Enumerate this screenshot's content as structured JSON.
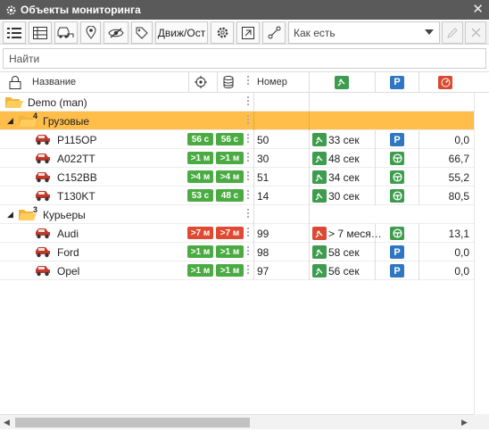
{
  "window": {
    "title": "Объекты мониторинга"
  },
  "toolbar": {
    "move_stop_label": "Движ/Ост",
    "mode_value": "Как есть",
    "buttons": [
      "list-icon",
      "table-icon",
      "vehicles-icon",
      "geofence-icon",
      "hide-icon",
      "tag-icon",
      "settings-icon",
      "export-icon",
      "route-icon",
      "edit-icon",
      "close-icon"
    ]
  },
  "search": {
    "placeholder": "Найти"
  },
  "columns": {
    "name": "Название",
    "number": "Номер"
  },
  "tree": {
    "root": "Demo (man)",
    "groups": [
      {
        "label": "Грузовые",
        "count": "4"
      },
      {
        "label": "Курьеры",
        "count": "3"
      }
    ]
  },
  "units": [
    {
      "name": "P115OP",
      "b1": "56 с",
      "b2": "56 с",
      "b1_color": "#4bab43",
      "b2_color": "#4bab43",
      "number": "50",
      "time": "33 сек",
      "sensor": "green",
      "value": "0,0"
    },
    {
      "name": "A022TT",
      "b1": ">1 м",
      "b2": ">1 м",
      "b1_color": "#4bab43",
      "b2_color": "#4bab43",
      "number": "30",
      "time": "48 сек",
      "sensor": "wheel",
      "value": "66,7"
    },
    {
      "name": "C152BB",
      "b1": ">4 м",
      "b2": ">4 м",
      "b1_color": "#4bab43",
      "b2_color": "#4bab43",
      "number": "51",
      "time": "34 сек",
      "sensor": "wheel",
      "value": "55,2"
    },
    {
      "name": "T130KT",
      "b1": "53 с",
      "b2": "48 с",
      "b1_color": "#4bab43",
      "b2_color": "#4bab43",
      "number": "14",
      "time": "30 сек",
      "sensor": "wheel",
      "value": "80,5"
    },
    {
      "name": "Audi",
      "b1": ">7 м",
      "b2": ">7 м",
      "b1_color": "#e04a32",
      "b2_color": "#e04a32",
      "number": "99",
      "time": "> 7 меся…",
      "sensor": "wheel",
      "value": "13,1"
    },
    {
      "name": "Ford",
      "b1": ">1 м",
      "b2": ">1 м",
      "b1_color": "#4bab43",
      "b2_color": "#4bab43",
      "number": "98",
      "time": "58 сек",
      "sensor": "parking",
      "value": "0,0"
    },
    {
      "name": "Opel",
      "b1": ">1 м",
      "b2": ">1 м",
      "b1_color": "#4bab43",
      "b2_color": "#4bab43",
      "number": "97",
      "time": "56 сек",
      "sensor": "parking",
      "value": "0,0"
    }
  ],
  "parking_label": "P",
  "colors": {
    "accent": "#ffbd4a",
    "titlebar": "#5a5a5a",
    "green": "#4bab43",
    "red": "#e04a32",
    "blue": "#2f77c0"
  }
}
